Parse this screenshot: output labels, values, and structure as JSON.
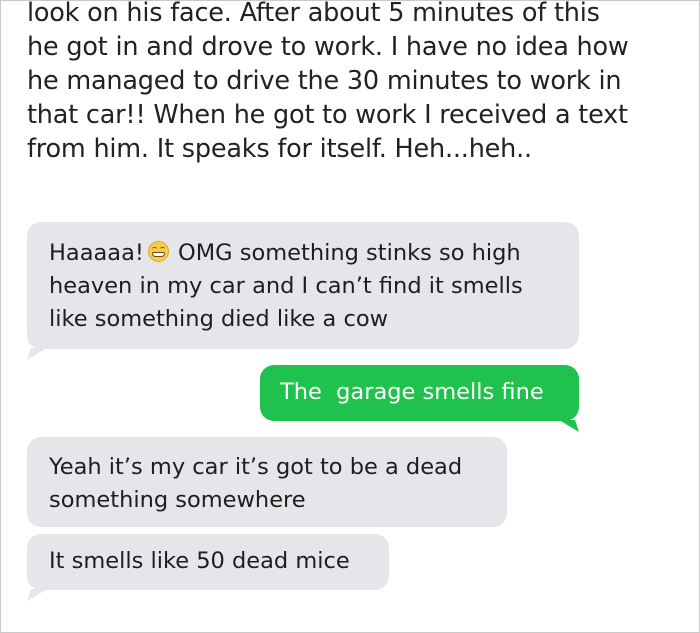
{
  "story": {
    "lines": [
      "look on his face. After about 5 minutes of this",
      "he got in and drove to work. I have no idea how",
      "he managed to drive the 30 minutes to work in",
      "that car!! When he got to work I received a text",
      "from him. It speaks for itself. Heh...heh.."
    ]
  },
  "messages": [
    {
      "direction": "incoming",
      "lines": [
        "Haaaaa!",
        "OMG something stinks so high",
        "heaven in my car and I can’t find it smells",
        "like something died like a cow"
      ],
      "emoji": "grinning-face-emoji"
    },
    {
      "direction": "outgoing",
      "lines": [
        "The  garage smells fine"
      ]
    },
    {
      "direction": "incoming",
      "lines": [
        "Yeah it’s my car it’s got to be a dead",
        "something somewhere"
      ]
    },
    {
      "direction": "incoming",
      "lines": [
        "It smells like 50 dead mice"
      ]
    }
  ],
  "colors": {
    "incoming_bubble": "#e5e5ea",
    "outgoing_bubble": "#1fc24c",
    "story_text": "#222222",
    "frame_border": "#c9c9c9"
  }
}
